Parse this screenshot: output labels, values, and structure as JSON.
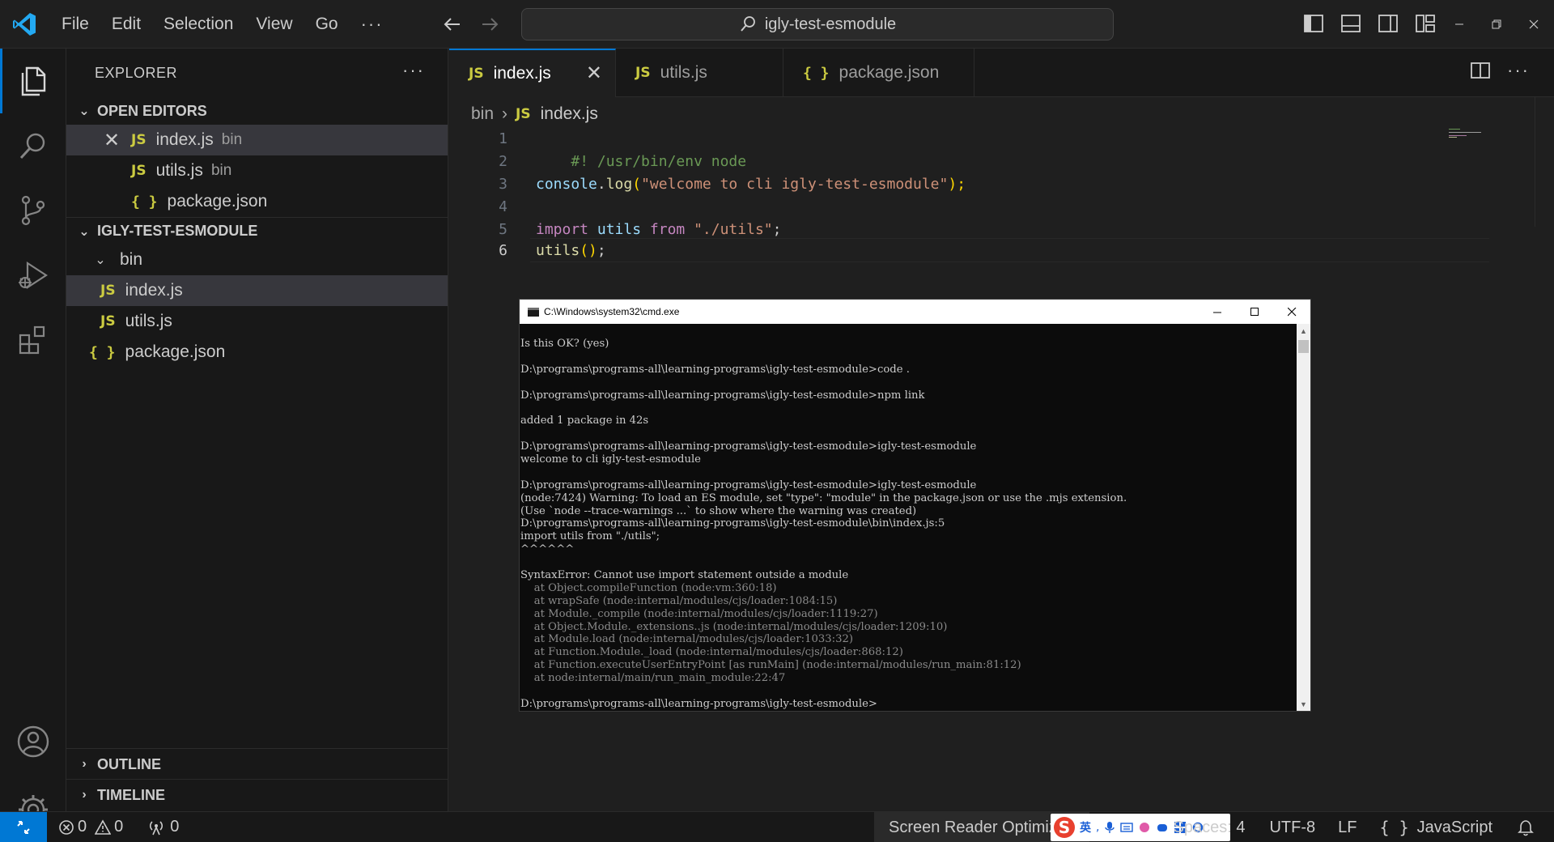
{
  "titlebar": {
    "menu": [
      "File",
      "Edit",
      "Selection",
      "View",
      "Go"
    ],
    "more": "···",
    "search": "igly-test-esmodule"
  },
  "sidebar": {
    "title": "EXPLORER",
    "more": "···",
    "open_editors": {
      "label": "OPEN EDITORS",
      "items": [
        {
          "name": "index.js",
          "desc": "bin",
          "badge": "JS"
        },
        {
          "name": "utils.js",
          "desc": "bin",
          "badge": "JS"
        },
        {
          "name": "package.json",
          "desc": "",
          "badge": "{ }"
        }
      ]
    },
    "project": {
      "label": "IGLY-TEST-ESMODULE",
      "folder": "bin",
      "files": [
        {
          "name": "index.js",
          "badge": "JS"
        },
        {
          "name": "utils.js",
          "badge": "JS"
        },
        {
          "name": "package.json",
          "badge": "{ }"
        }
      ]
    },
    "outline": "OUTLINE",
    "timeline": "TIMELINE"
  },
  "tabs": [
    {
      "name": "index.js",
      "badge": "JS",
      "active": true
    },
    {
      "name": "utils.js",
      "badge": "JS",
      "active": false
    },
    {
      "name": "package.json",
      "badge": "{ }",
      "active": false
    }
  ],
  "breadcrumb": {
    "folder": "bin",
    "file": "index.js",
    "badge": "JS"
  },
  "code": {
    "line_numbers": [
      "1",
      "2",
      "3",
      "4",
      "5",
      "6"
    ],
    "line1": "#! /usr/bin/env node",
    "line3": {
      "obj": "console",
      "dot": ".",
      "fn": "log",
      "open": "(",
      "str": "\"welcome to cli igly-test-esmodule\"",
      "close": ");"
    },
    "line5": {
      "kw1": "import",
      "id": " utils ",
      "kw2": "from",
      "str": " \"./utils\"",
      "semi": ";"
    },
    "line6": {
      "fn": "utils",
      "open": "(",
      "close": ")",
      "semi": ";"
    }
  },
  "cmd": {
    "title": "C:\\Windows\\system32\\cmd.exe",
    "lines": [
      {
        "t": "Is this OK? (yes)",
        "g": false
      },
      {
        "t": "",
        "g": false
      },
      {
        "t": "D:\\programs\\programs-all\\learning-programs\\igly-test-esmodule>code .",
        "g": false
      },
      {
        "t": "",
        "g": false
      },
      {
        "t": "D:\\programs\\programs-all\\learning-programs\\igly-test-esmodule>npm link",
        "g": false
      },
      {
        "t": "",
        "g": false
      },
      {
        "t": "added 1 package in 42s",
        "g": false
      },
      {
        "t": "",
        "g": false
      },
      {
        "t": "D:\\programs\\programs-all\\learning-programs\\igly-test-esmodule>igly-test-esmodule",
        "g": false
      },
      {
        "t": "welcome to cli igly-test-esmodule",
        "g": false
      },
      {
        "t": "",
        "g": false
      },
      {
        "t": "D:\\programs\\programs-all\\learning-programs\\igly-test-esmodule>igly-test-esmodule",
        "g": false
      },
      {
        "t": "(node:7424) Warning: To load an ES module, set \"type\": \"module\" in the package.json or use the .mjs extension.",
        "g": false
      },
      {
        "t": "(Use `node --trace-warnings ...` to show where the warning was created)",
        "g": false
      },
      {
        "t": "D:\\programs\\programs-all\\learning-programs\\igly-test-esmodule\\bin\\index.js:5",
        "g": false
      },
      {
        "t": "import utils from \"./utils\";",
        "g": false
      },
      {
        "t": "^^^^^^",
        "g": false
      },
      {
        "t": "",
        "g": false
      },
      {
        "t": "SyntaxError: Cannot use import statement outside a module",
        "g": false
      },
      {
        "t": "    at Object.compileFunction (node:vm:360:18)",
        "g": true
      },
      {
        "t": "    at wrapSafe (node:internal/modules/cjs/loader:1084:15)",
        "g": true
      },
      {
        "t": "    at Module._compile (node:internal/modules/cjs/loader:1119:27)",
        "g": true
      },
      {
        "t": "    at Object.Module._extensions..js (node:internal/modules/cjs/loader:1209:10)",
        "g": true
      },
      {
        "t": "    at Module.load (node:internal/modules/cjs/loader:1033:32)",
        "g": true
      },
      {
        "t": "    at Function.Module._load (node:internal/modules/cjs/loader:868:12)",
        "g": true
      },
      {
        "t": "    at Function.executeUserEntryPoint [as runMain] (node:internal/modules/run_main:81:12)",
        "g": true
      },
      {
        "t": "    at node:internal/main/run_main_module:22:47",
        "g": true
      },
      {
        "t": "",
        "g": false
      },
      {
        "t": "D:\\programs\\programs-all\\learning-programs\\igly-test-esmodule>",
        "g": false
      }
    ]
  },
  "statusbar": {
    "errors": "0",
    "warnings": "0",
    "ports": "0",
    "screen_reader": "Screen Reader Optimized",
    "spaces": "Spaces: 4",
    "encoding": "UTF-8",
    "eol": "LF",
    "language_badge": "{ }",
    "language": "JavaScript",
    "ime_logo": "S",
    "ime_lang": "英"
  },
  "colors": {
    "accent": "#0078d4",
    "js_badge": "#cbcb41",
    "keyword": "#c586c0",
    "string": "#ce9178",
    "function": "#dcdcaa",
    "variable": "#9cdcfe",
    "comment": "#6a9955"
  }
}
